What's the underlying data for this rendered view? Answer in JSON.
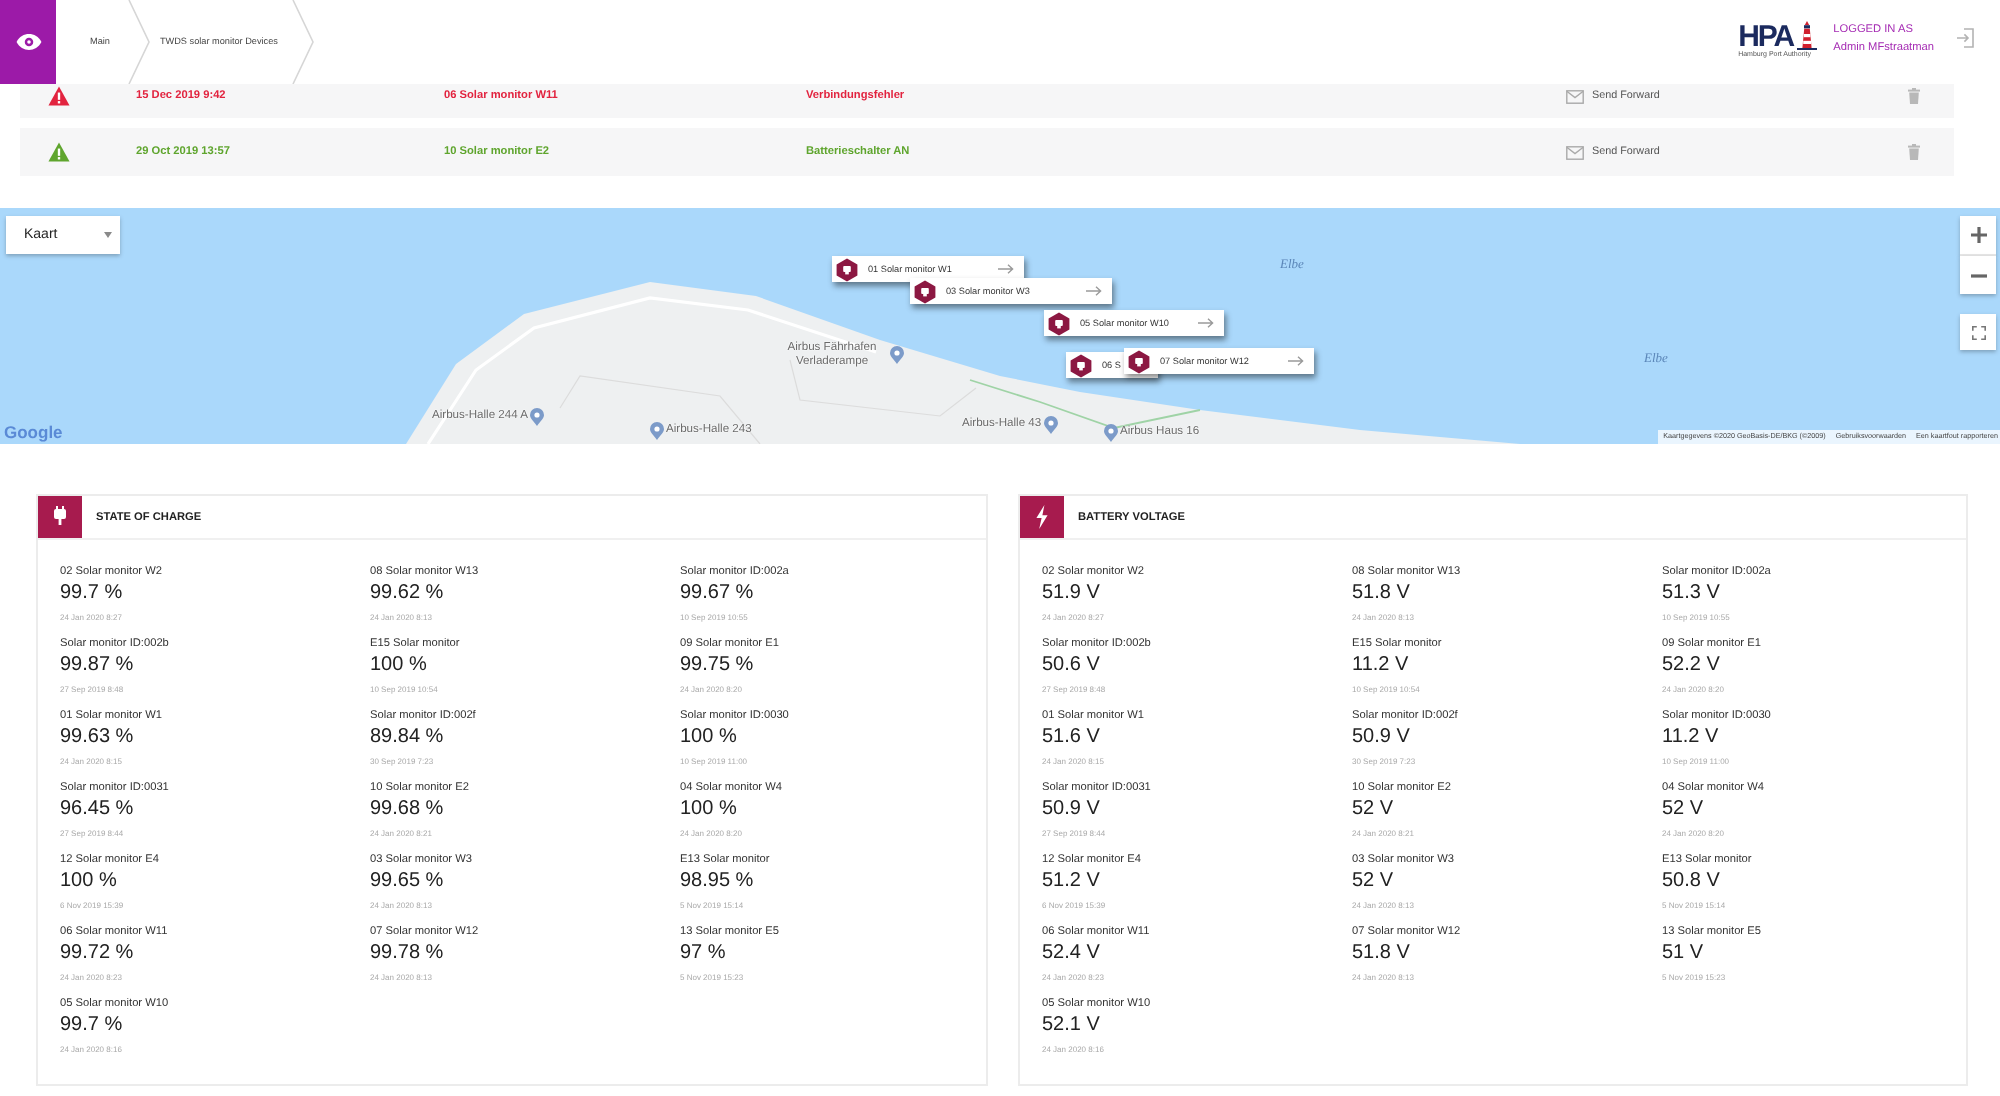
{
  "header": {
    "breadcrumbs": [
      "Main",
      "TWDS solar monitor Devices"
    ],
    "logo": {
      "text": "HPA",
      "subtitle": "Hamburg Port Authority"
    },
    "user": {
      "caption": "LOGGED IN AS",
      "name": "Admin MFstraatman"
    }
  },
  "alerts": [
    {
      "color": "#e2233f",
      "time": "15 Dec 2019 9:42",
      "device": "06 Solar monitor W11",
      "message": "Verbindungsfehler",
      "action": "Send Forward"
    },
    {
      "color": "#5fa52e",
      "time": "29 Oct 2019 13:57",
      "device": "10 Solar monitor E2",
      "message": "Batterieschalter AN",
      "action": "Send Forward"
    }
  ],
  "map": {
    "map_type": "Kaart",
    "places": [
      {
        "kind": "water",
        "label": "Elbe"
      },
      {
        "kind": "poi",
        "label": "Airbus Fährhafen Verladerampe"
      },
      {
        "kind": "water",
        "label": "Elbe"
      },
      {
        "kind": "poi",
        "label": "Airbus-Halle 244 A"
      },
      {
        "kind": "poi",
        "label": "Airbus-Halle 243"
      },
      {
        "kind": "poi",
        "label": "Airbus-Halle 43"
      },
      {
        "kind": "poi",
        "label": "Airbus Haus 16"
      }
    ],
    "markers": [
      {
        "label": "01 Solar monitor W1",
        "arrow": true
      },
      {
        "label": "03 Solar monitor W3",
        "arrow": true
      },
      {
        "label": "05 Solar monitor W10",
        "arrow": true
      },
      {
        "label": "06 S",
        "arrow": false
      },
      {
        "label": "07 Solar monitor W12",
        "arrow": true
      }
    ],
    "logo": "Google",
    "attribution": [
      "Kaartgegevens ©2020 GeoBasis-DE/BKG (©2009)",
      "Gebruiksvoorwaarden",
      "Een kaartfout rapporteren"
    ]
  },
  "panels": [
    {
      "kind": "charge",
      "title": "STATE OF CHARGE",
      "items": [
        {
          "name": "02 Solar monitor W2",
          "value": "99.7 %",
          "time": "24 Jan 2020 8:27"
        },
        {
          "name": "08 Solar monitor W13",
          "value": "99.62 %",
          "time": "24 Jan 2020 8:13"
        },
        {
          "name": "Solar monitor ID:002a",
          "value": "99.67 %",
          "time": "10 Sep 2019 10:55"
        },
        {
          "name": "Solar monitor ID:002b",
          "value": "99.87 %",
          "time": "27 Sep 2019 8:48"
        },
        {
          "name": "E15 Solar monitor",
          "value": "100 %",
          "time": "10 Sep 2019 10:54"
        },
        {
          "name": "09 Solar monitor E1",
          "value": "99.75 %",
          "time": "24 Jan 2020 8:20"
        },
        {
          "name": "01 Solar monitor W1",
          "value": "99.63 %",
          "time": "24 Jan 2020 8:15"
        },
        {
          "name": "Solar monitor ID:002f",
          "value": "89.84 %",
          "time": "30 Sep 2019 7:23"
        },
        {
          "name": "Solar monitor ID:0030",
          "value": "100 %",
          "time": "10 Sep 2019 11:00"
        },
        {
          "name": "Solar monitor ID:0031",
          "value": "96.45 %",
          "time": "27 Sep 2019 8:44"
        },
        {
          "name": "10 Solar monitor E2",
          "value": "99.68 %",
          "time": "24 Jan 2020 8:21"
        },
        {
          "name": "04 Solar monitor W4",
          "value": "100 %",
          "time": "24 Jan 2020 8:20"
        },
        {
          "name": "12 Solar monitor E4",
          "value": "100 %",
          "time": "6 Nov 2019 15:39"
        },
        {
          "name": "03 Solar monitor W3",
          "value": "99.65 %",
          "time": "24 Jan 2020 8:13"
        },
        {
          "name": "E13 Solar monitor",
          "value": "98.95 %",
          "time": "5 Nov 2019 15:14"
        },
        {
          "name": "06 Solar monitor W11",
          "value": "99.72 %",
          "time": "24 Jan 2020 8:23"
        },
        {
          "name": "07 Solar monitor W12",
          "value": "99.78 %",
          "time": "24 Jan 2020 8:13"
        },
        {
          "name": "13 Solar monitor E5",
          "value": "97 %",
          "time": "5 Nov 2019 15:23"
        },
        {
          "name": "05 Solar monitor W10",
          "value": "99.7 %",
          "time": "24 Jan 2020 8:16"
        }
      ]
    },
    {
      "kind": "voltage",
      "title": "BATTERY VOLTAGE",
      "items": [
        {
          "name": "02 Solar monitor W2",
          "value": "51.9 V",
          "time": "24 Jan 2020 8:27"
        },
        {
          "name": "08 Solar monitor W13",
          "value": "51.8 V",
          "time": "24 Jan 2020 8:13"
        },
        {
          "name": "Solar monitor ID:002a",
          "value": "51.3 V",
          "time": "10 Sep 2019 10:55"
        },
        {
          "name": "Solar monitor ID:002b",
          "value": "50.6 V",
          "time": "27 Sep 2019 8:48"
        },
        {
          "name": "E15 Solar monitor",
          "value": "11.2 V",
          "time": "10 Sep 2019 10:54"
        },
        {
          "name": "09 Solar monitor E1",
          "value": "52.2 V",
          "time": "24 Jan 2020 8:20"
        },
        {
          "name": "01 Solar monitor W1",
          "value": "51.6 V",
          "time": "24 Jan 2020 8:15"
        },
        {
          "name": "Solar monitor ID:002f",
          "value": "50.9 V",
          "time": "30 Sep 2019 7:23"
        },
        {
          "name": "Solar monitor ID:0030",
          "value": "11.2 V",
          "time": "10 Sep 2019 11:00"
        },
        {
          "name": "Solar monitor ID:0031",
          "value": "50.9 V",
          "time": "27 Sep 2019 8:44"
        },
        {
          "name": "10 Solar monitor E2",
          "value": "52 V",
          "time": "24 Jan 2020 8:21"
        },
        {
          "name": "04 Solar monitor W4",
          "value": "52 V",
          "time": "24 Jan 2020 8:20"
        },
        {
          "name": "12 Solar monitor E4",
          "value": "51.2 V",
          "time": "6 Nov 2019 15:39"
        },
        {
          "name": "03 Solar monitor W3",
          "value": "52 V",
          "time": "24 Jan 2020 8:13"
        },
        {
          "name": "E13 Solar monitor",
          "value": "50.8 V",
          "time": "5 Nov 2019 15:14"
        },
        {
          "name": "06 Solar monitor W11",
          "value": "52.4 V",
          "time": "24 Jan 2020 8:23"
        },
        {
          "name": "07 Solar monitor W12",
          "value": "51.8 V",
          "time": "24 Jan 2020 8:13"
        },
        {
          "name": "13 Solar monitor E5",
          "value": "51 V",
          "time": "5 Nov 2019 15:23"
        },
        {
          "name": "05 Solar monitor W10",
          "value": "52.1 V",
          "time": "24 Jan 2020 8:16"
        }
      ]
    }
  ]
}
